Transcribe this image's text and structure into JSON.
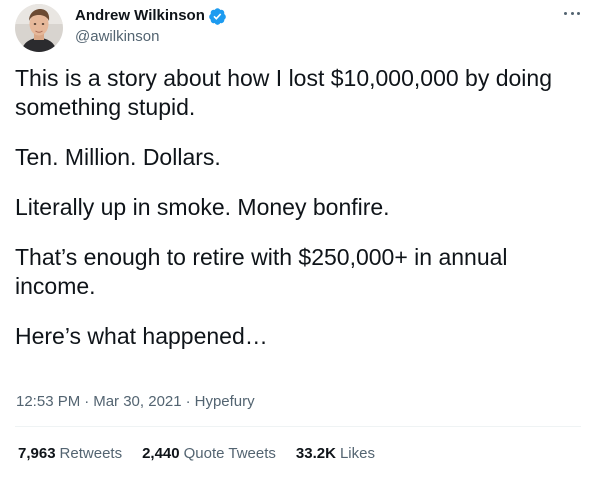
{
  "author": {
    "display_name": "Andrew Wilkinson",
    "handle": "@awilkinson",
    "verified": true
  },
  "tweet": {
    "paragraphs": [
      "This is a story about how I lost $10,000,000 by doing something stupid.",
      "Ten. Million. Dollars.",
      "Literally up in smoke. Money bonfire.",
      "That’s enough to retire with $250,000+ in annual income.",
      "Here’s what happened…"
    ]
  },
  "meta": {
    "time": "12:53 PM",
    "separator": "·",
    "date": "Mar 30, 2021",
    "source": "Hypefury"
  },
  "stats": {
    "retweets": {
      "count": "7,963",
      "label": "Retweets"
    },
    "quote_tweets": {
      "count": "2,440",
      "label": "Quote Tweets"
    },
    "likes": {
      "count": "33.2K",
      "label": "Likes"
    }
  },
  "icons": {
    "verified": "verified-badge-icon",
    "more": "more-options-icon"
  },
  "colors": {
    "text_primary": "#0f1419",
    "text_secondary": "#536471",
    "verified_blue": "#1d9bf0",
    "divider": "#eff3f4"
  }
}
